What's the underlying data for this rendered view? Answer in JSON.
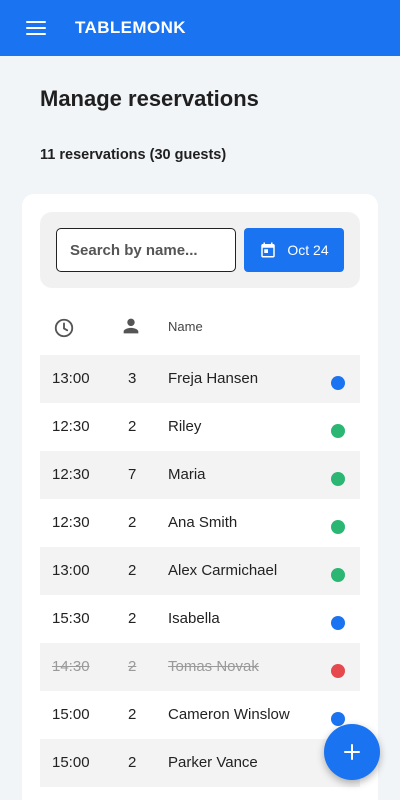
{
  "app": {
    "name": "TABLEMONK"
  },
  "header": {
    "menu_icon": "menu-icon"
  },
  "page": {
    "title": "Manage reservations",
    "summary": "11 reservations (30 guests)"
  },
  "filters": {
    "search_placeholder": "Search by name...",
    "date_label": "Oct 24",
    "date_icon": "calendar-icon"
  },
  "table": {
    "columns": {
      "time_icon": "clock-icon",
      "guests_icon": "person-icon",
      "name": "Name"
    },
    "rows": [
      {
        "time": "13:00",
        "guests": "3",
        "name": "Freja Hansen",
        "status_color": "#1a73f0",
        "cancelled": false
      },
      {
        "time": "12:30",
        "guests": "2",
        "name": "Riley",
        "status_color": "#2bb673",
        "cancelled": false
      },
      {
        "time": "12:30",
        "guests": "7",
        "name": "Maria",
        "status_color": "#2bb673",
        "cancelled": false
      },
      {
        "time": "12:30",
        "guests": "2",
        "name": "Ana Smith",
        "status_color": "#2bb673",
        "cancelled": false
      },
      {
        "time": "13:00",
        "guests": "2",
        "name": "Alex Carmichael",
        "status_color": "#2bb673",
        "cancelled": false
      },
      {
        "time": "15:30",
        "guests": "2",
        "name": "Isabella",
        "status_color": "#1a73f0",
        "cancelled": false
      },
      {
        "time": "14:30",
        "guests": "2",
        "name": "Tomas Novak",
        "status_color": "#e5484d",
        "cancelled": true
      },
      {
        "time": "15:00",
        "guests": "2",
        "name": "Cameron Winslow",
        "status_color": "#1a73f0",
        "cancelled": false
      },
      {
        "time": "15:00",
        "guests": "2",
        "name": "Parker Vance",
        "status_color": "#1a73f0",
        "cancelled": false
      }
    ]
  },
  "fab": {
    "icon": "plus-icon"
  },
  "colors": {
    "primary": "#1a73f0",
    "confirmed": "#2bb673",
    "cancelled": "#e5484d",
    "background": "#f2f5f8"
  }
}
